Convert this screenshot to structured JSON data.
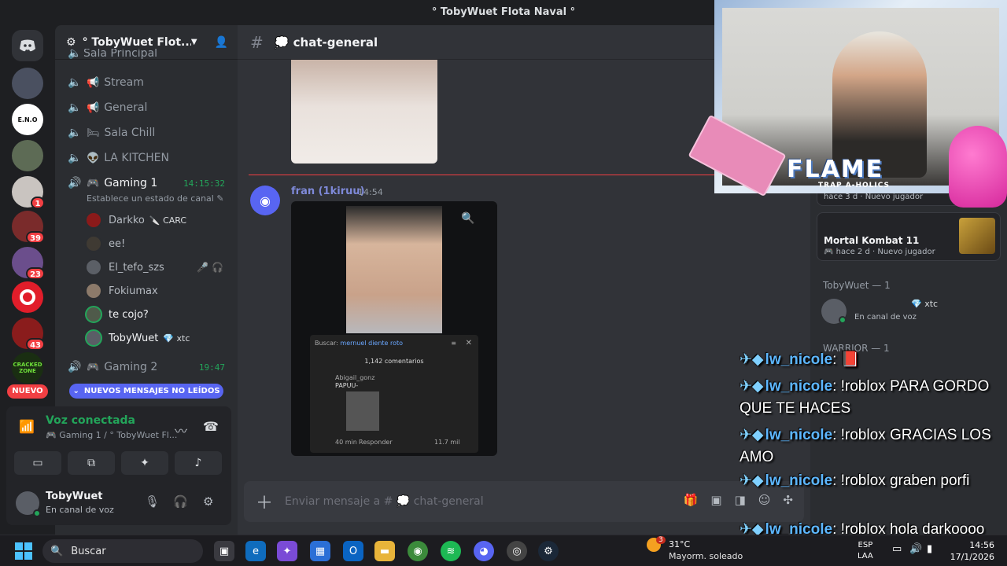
{
  "window": {
    "title": "° TobyWuet Flota Naval °"
  },
  "rail": {
    "badges": [
      "1",
      "39",
      "23",
      "43"
    ],
    "nuevo": "NUEVO",
    "zone_text": "CRACKED ZONE",
    "eno_text": "E.N.O"
  },
  "sidebar": {
    "server_name": "° TobyWuet Flot...",
    "partial_channel": "Sala Principal",
    "channels": [
      {
        "emoji": "📢",
        "name": "Stream"
      },
      {
        "emoji": "📢",
        "name": "General"
      },
      {
        "emoji": "🛏",
        "name": "Sala Chill"
      },
      {
        "emoji": "👽",
        "name": "LA KITCHEN"
      }
    ],
    "gaming1": {
      "emoji": "🎮",
      "name": "Gaming 1",
      "time": "14:15:32",
      "status": "Establece un estado de canal ✎"
    },
    "voice_users": [
      {
        "name": "Darkko",
        "tag": "🔪 CARC"
      },
      {
        "name": "ee!",
        "tag": ""
      },
      {
        "name": "El_tefo_szs",
        "tag": ""
      },
      {
        "name": "Fokiumax",
        "tag": ""
      },
      {
        "name": "te cojo?",
        "tag": ""
      },
      {
        "name": "TobyWuet",
        "tag": "💎 xtc"
      }
    ],
    "gaming2": {
      "emoji": "🎮",
      "name": "Gaming 2",
      "time": "19:47"
    },
    "new_messages": "NUEVOS MENSAJES NO LEÍDOS",
    "voice_panel": {
      "title": "Voz conectada",
      "subtitle": "🎮 Gaming 1 / ° TobyWuet Fl..."
    },
    "user": {
      "name": "TobyWuet",
      "status": "En canal de voz"
    }
  },
  "chat": {
    "channel": "💭 chat-general",
    "message": {
      "author": "fran (1kiruu)",
      "time": "14:54"
    },
    "yt": {
      "search_label": "Buscar:",
      "search_query": "mernuel diente roto",
      "comments": "1,142 comentarios",
      "commenter": "Abigail_gonz",
      "comment": "PAPUU-",
      "age": "40 min",
      "reply": "Responder",
      "likes": "11.7 mil"
    },
    "composer_placeholder": "Enviar mensaje a # 💭 chat-general"
  },
  "members": {
    "activity1_meta": "hace 3 d · Nuevo jugador",
    "activity2": {
      "game": "Mortal Kombat 11",
      "meta": "🎮 hace 2 d · Nuevo jugador"
    },
    "role1": "TobyWuet — 1",
    "member1": {
      "tag": "💎 xtc",
      "status": "En canal de voz"
    },
    "role2": "WARRIOR — 1"
  },
  "overlay": {
    "brand": "FLAME",
    "brand_sub": "TRAP A-HOLICS",
    "lines": [
      {
        "nick": "lw_nicole",
        "text": ": 📕"
      },
      {
        "nick": "lw_nicole",
        "text": ": !roblox PARA GORDO QUE TE HACES"
      },
      {
        "nick": "lw_nicole",
        "text": ": !roblox GRACIAS LOS AMO"
      },
      {
        "nick": "lw_nicole",
        "text": ": !roblox graben porfi"
      },
      {
        "nick": "lw_nicole",
        "text": ": !roblox hola darkoooo"
      }
    ]
  },
  "taskbar": {
    "search": "Buscar",
    "weather_temp": "31°C",
    "weather_desc": "Mayorm. soleado",
    "weather_badge": "3",
    "lang1": "ESP",
    "lang2": "LAA",
    "time": "14:56",
    "date": "17/1/2026"
  }
}
